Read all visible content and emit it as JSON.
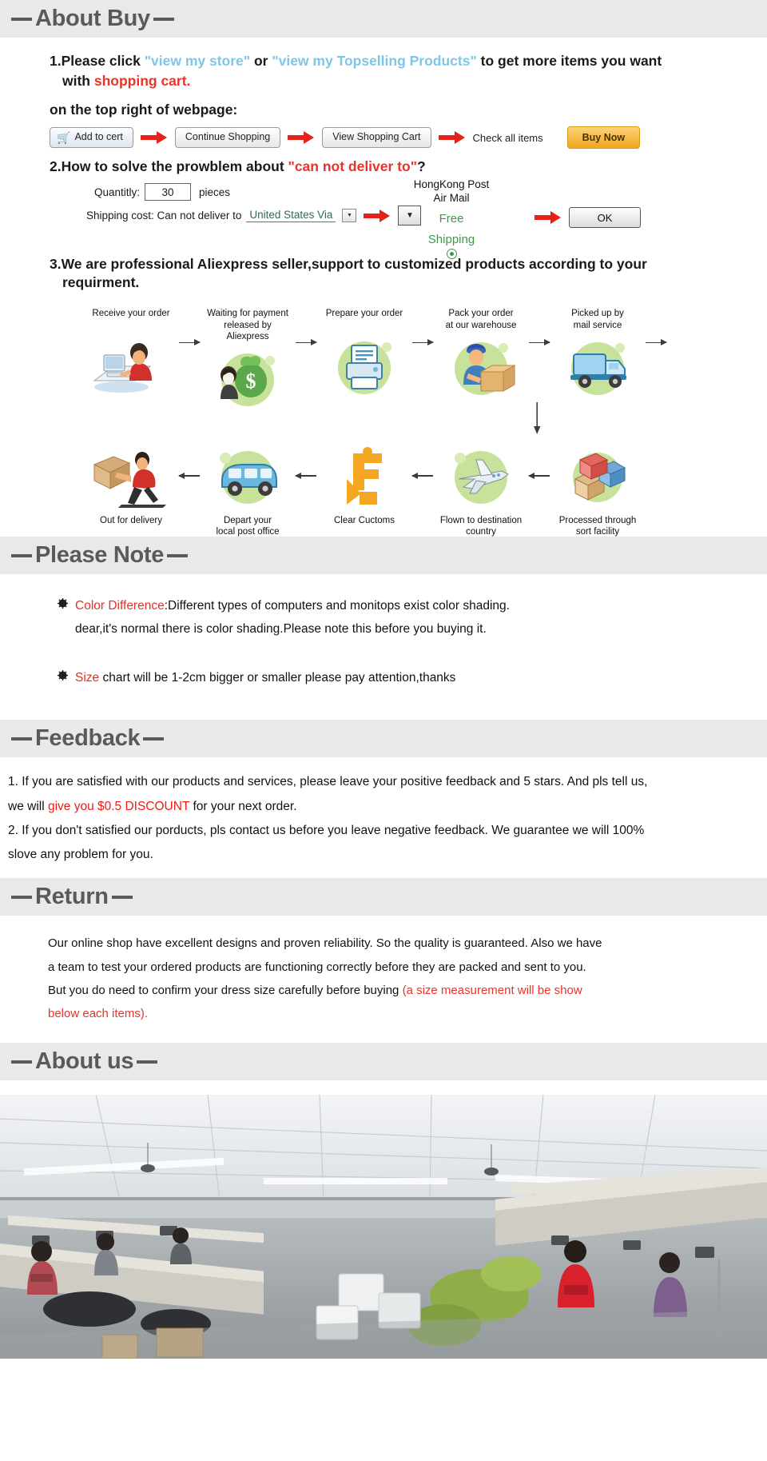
{
  "sections": {
    "about_buy": "About Buy",
    "please_note": "Please Note",
    "feedback": "Feedback",
    "return": "Return",
    "about_us": "About us"
  },
  "about_buy": {
    "item1": {
      "number": "1.",
      "prefix": "Please click ",
      "link1": "\"view my store\"",
      "mid": " or ",
      "link2": "\"view my Topselling Products\"",
      "suffix": " to get more items you want",
      "line2_prefix": "with ",
      "line2_red": "shopping cart.",
      "line3": "on the top right of webpage:"
    },
    "buttons": {
      "add_to_cart": "Add to cert",
      "cart_icon": "shopping-cart-icon",
      "continue_shopping": "Continue Shopping",
      "view_cart": "View Shopping Cart",
      "check_all": "Check all items",
      "buy_now": "Buy Now"
    },
    "item2": {
      "number": "2.",
      "prefix": "How to solve the prowblem about ",
      "red": "\"can not deliver to\"",
      "suffix": "?",
      "quantity_label": "Quantitly:",
      "quantity_value": "30",
      "quantity_unit": "pieces",
      "shipping_label": "Shipping cost: Can not deliver to",
      "country_value": "United States Via",
      "dropdown_glyph": "▼",
      "hk_line1": "HongKong Post",
      "hk_line2": "Air Mail",
      "free_line1": "Free",
      "free_line2": "Shipping",
      "ok_label": "OK"
    },
    "item3": {
      "number": "3.",
      "line1": "We are professional Aliexpress seller,support to customized products according to your",
      "line2": "requirment."
    },
    "flow_top": [
      "Receive your order",
      "Waiting for payment\nreleased by Aliexpress",
      "Prepare your order",
      "Pack your order\nat our warehouse",
      "Picked up by\nmail service"
    ],
    "flow_bottom": [
      "Out for delivery",
      "Depart your\nlocal post office",
      "Clear Cuctoms",
      "Flown to destination\ncountry",
      "Processed through\nsort facility"
    ]
  },
  "please_note": {
    "item1_red": "Color Difference",
    "item1_rest": ":Different types of computers and monitops exist color shading.",
    "item1_line2": "dear,it's normal there is color shading.Please note this before you buying it.",
    "item2_red": "Size",
    "item2_rest": " chart will be 1-2cm bigger or smaller please pay attention,thanks",
    "bullet_icon": "gear-icon"
  },
  "feedback": {
    "line1a": "1. If you are satisfied with our products and services, please leave your positive feedback and 5 stars. And pls tell us,",
    "line2_prefix": "we will ",
    "line2_red": "give you $0.5  DISCOUNT",
    "line2_suffix": " for your next order.",
    "line3": "2. If you don't satisfied our porducts, pls contact us before you leave negative feedback. We guarantee we will 100%",
    "line4": "slove any problem for you."
  },
  "return_policy": {
    "line1": "Our online shop have excellent designs and proven reliability. So the quality is guaranteed. Also we have",
    "line2": "a team to test your ordered products are functioning correctly before they are packed and sent to you.",
    "line3_black": "But you do need to confirm your dress size carefully before buying ",
    "line3_red": "(a size measurement will be show",
    "line4_red": "below each items)."
  },
  "colors": {
    "heading_gray": "#5a5a5a",
    "bar_bg": "#e9e9e9",
    "link_blue": "#7ec6e8",
    "alert_red": "#e8342a",
    "green": "#3a9a4a",
    "flow_green": "#c7e39b",
    "buy_now_yellow": "#f0a720"
  }
}
